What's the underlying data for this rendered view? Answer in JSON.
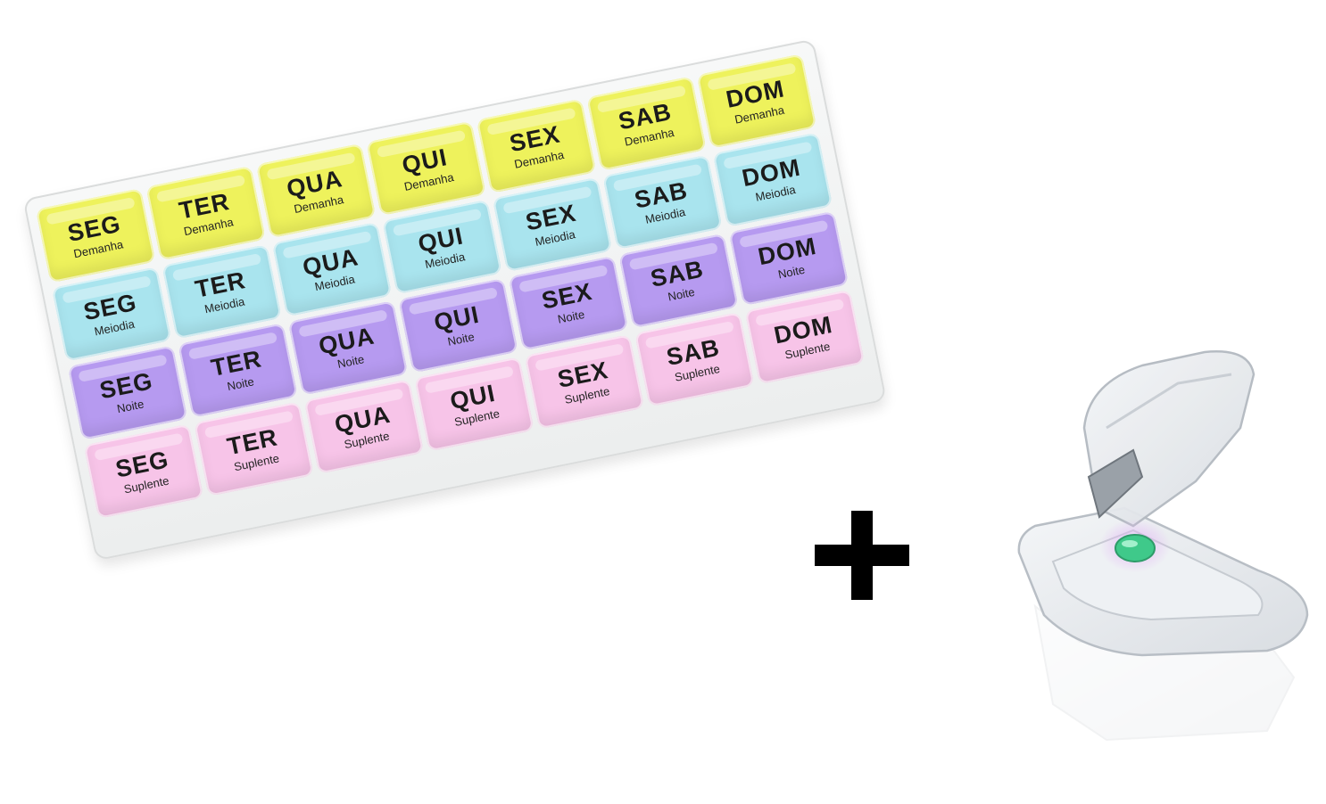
{
  "organizer": {
    "colors": {
      "demanha": "#eef25c",
      "meiodia": "#a9e4ee",
      "noite": "#b69af0",
      "suplente": "#f7c4e8",
      "tray": "#f2f3f3"
    },
    "rows": [
      {
        "color_key": "demanha",
        "cells": [
          {
            "day": "SEG",
            "slot": "Demanha"
          },
          {
            "day": "TER",
            "slot": "Demanha"
          },
          {
            "day": "QUA",
            "slot": "Demanha"
          },
          {
            "day": "QUI",
            "slot": "Demanha"
          },
          {
            "day": "SEX",
            "slot": "Demanha"
          },
          {
            "day": "SAB",
            "slot": "Demanha"
          },
          {
            "day": "DOM",
            "slot": "Demanha"
          }
        ]
      },
      {
        "color_key": "meiodia",
        "cells": [
          {
            "day": "SEG",
            "slot": "Meiodia"
          },
          {
            "day": "TER",
            "slot": "Meiodia"
          },
          {
            "day": "QUA",
            "slot": "Meiodia"
          },
          {
            "day": "QUI",
            "slot": "Meiodia"
          },
          {
            "day": "SEX",
            "slot": "Meiodia"
          },
          {
            "day": "SAB",
            "slot": "Meiodia"
          },
          {
            "day": "DOM",
            "slot": "Meiodia"
          }
        ]
      },
      {
        "color_key": "noite",
        "cells": [
          {
            "day": "SEG",
            "slot": "Noite"
          },
          {
            "day": "TER",
            "slot": "Noite"
          },
          {
            "day": "QUA",
            "slot": "Noite"
          },
          {
            "day": "QUI",
            "slot": "Noite"
          },
          {
            "day": "SEX",
            "slot": "Noite"
          },
          {
            "day": "SAB",
            "slot": "Noite"
          },
          {
            "day": "DOM",
            "slot": "Noite"
          }
        ]
      },
      {
        "color_key": "suplente",
        "cells": [
          {
            "day": "SEG",
            "slot": "Suplente"
          },
          {
            "day": "TER",
            "slot": "Suplente"
          },
          {
            "day": "QUA",
            "slot": "Suplente"
          },
          {
            "day": "QUI",
            "slot": "Suplente"
          },
          {
            "day": "SEX",
            "slot": "Suplente"
          },
          {
            "day": "SAB",
            "slot": "Suplente"
          },
          {
            "day": "DOM",
            "slot": "Suplente"
          }
        ]
      }
    ]
  },
  "plus_icon": "plus-icon",
  "cutter": {
    "icon": "pill-cutter-icon",
    "pill_color": "#3fc98a",
    "glow_color": "#d9a6f0"
  }
}
